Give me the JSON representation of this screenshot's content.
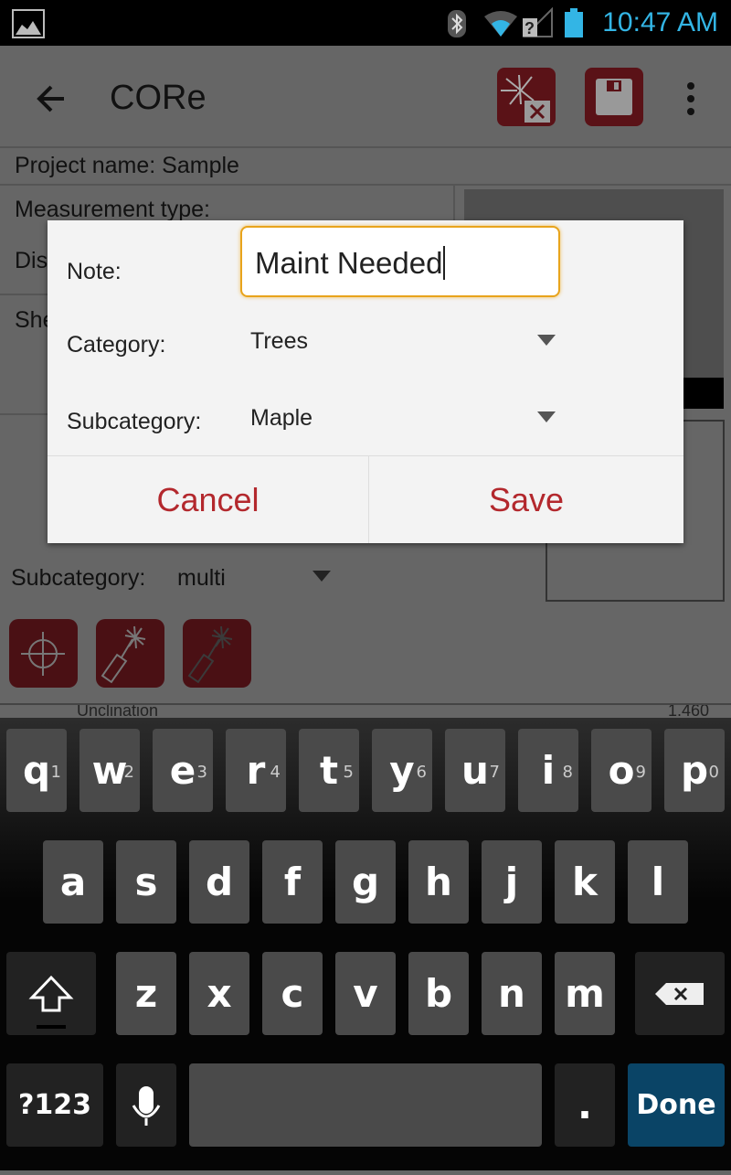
{
  "status": {
    "time": "10:47 AM",
    "icons": [
      "image-icon",
      "bluetooth-icon",
      "wifi-icon",
      "signal-unknown-icon",
      "battery-icon"
    ]
  },
  "toolbar": {
    "title": "CORe",
    "icons": [
      "back-arrow-icon",
      "laser-cancel-icon",
      "save-icon",
      "overflow-menu-icon"
    ],
    "accent": "#b3282d"
  },
  "background": {
    "project": "Project name: Sample",
    "measurement_type": "Measurement type:",
    "partial1": "Dis",
    "partial2": "She",
    "subcategory_label": "Subcategory:",
    "subcategory_value": "multi",
    "table_partial": "Unclination",
    "table_value": "1.460"
  },
  "dialog": {
    "note_label": "Note:",
    "note_value": "Maint Needed",
    "category_label": "Category:",
    "category_value": "Trees",
    "subcategory_label": "Subcategory:",
    "subcategory_value": "Maple",
    "cancel": "Cancel",
    "save": "Save"
  },
  "keyboard": {
    "row1": [
      "q",
      "w",
      "e",
      "r",
      "t",
      "y",
      "u",
      "i",
      "o",
      "p"
    ],
    "row1_hints": [
      "1",
      "2",
      "3",
      "4",
      "5",
      "6",
      "7",
      "8",
      "9",
      "0"
    ],
    "row2": [
      "a",
      "s",
      "d",
      "f",
      "g",
      "h",
      "j",
      "k",
      "l"
    ],
    "row3": [
      "z",
      "x",
      "c",
      "v",
      "b",
      "n",
      "m"
    ],
    "symbols": "?123",
    "period": ".",
    "done": "Done",
    "done_color": "#0a4466"
  }
}
